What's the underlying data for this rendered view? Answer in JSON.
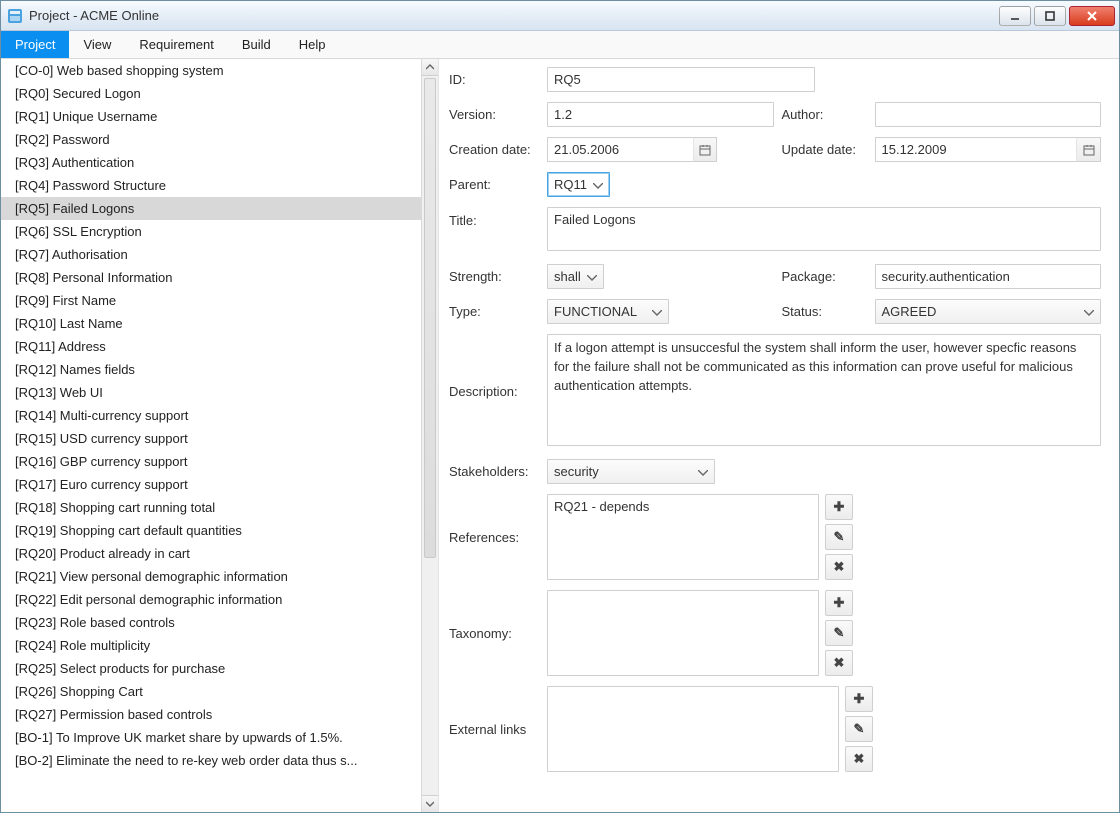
{
  "window": {
    "title": "Project - ACME Online"
  },
  "menu": {
    "items": [
      "Project",
      "View",
      "Requirement",
      "Build",
      "Help"
    ],
    "activeIndex": 0
  },
  "list": {
    "selectedIndex": 6,
    "items": [
      "[CO-0] Web based shopping system",
      "[RQ0] Secured Logon",
      "[RQ1] Unique Username",
      "[RQ2] Password",
      "[RQ3] Authentication",
      "[RQ4] Password Structure",
      "[RQ5] Failed Logons",
      "[RQ6] SSL Encryption",
      "[RQ7] Authorisation",
      "[RQ8] Personal Information",
      "[RQ9] First Name",
      "[RQ10] Last Name",
      "[RQ11] Address",
      "[RQ12] Names fields",
      "[RQ13] Web UI",
      "[RQ14] Multi-currency support",
      "[RQ15] USD currency support",
      "[RQ16] GBP currency support",
      "[RQ17] Euro currency support",
      "[RQ18] Shopping cart running total",
      "[RQ19] Shopping cart default quantities",
      "[RQ20] Product already in cart",
      "[RQ21] View personal demographic information",
      "[RQ22] Edit personal demographic information",
      "[RQ23] Role based controls",
      "[RQ24] Role multiplicity",
      "[RQ25] Select products for purchase",
      "[RQ26] Shopping Cart",
      "[RQ27] Permission based controls",
      "[BO-1] To Improve UK market share by upwards of 1.5%.",
      "[BO-2] Eliminate the need to re-key web order data thus s..."
    ]
  },
  "form": {
    "labels": {
      "id": "ID:",
      "version": "Version:",
      "author": "Author:",
      "creationDate": "Creation date:",
      "updateDate": "Update date:",
      "parent": "Parent:",
      "title": "Title:",
      "strength": "Strength:",
      "package": "Package:",
      "type": "Type:",
      "status": "Status:",
      "description": "Description:",
      "stakeholders": "Stakeholders:",
      "references": "References:",
      "taxonomy": "Taxonomy:",
      "externalLinks": "External links"
    },
    "values": {
      "id": "RQ5",
      "version": "1.2",
      "author": "",
      "creationDate": "21.05.2006",
      "updateDate": "15.12.2009",
      "parent": "RQ11",
      "title": "Failed Logons",
      "strength": "shall",
      "package": "security.authentication",
      "type": "FUNCTIONAL",
      "status": "AGREED",
      "description": "If a logon attempt is unsuccesful the system shall inform the user, however specfic reasons for the failure shall not be communicated as this information can prove useful for malicious authentication attempts.",
      "stakeholders": "security",
      "referencesItem": "RQ21 - depends"
    }
  }
}
